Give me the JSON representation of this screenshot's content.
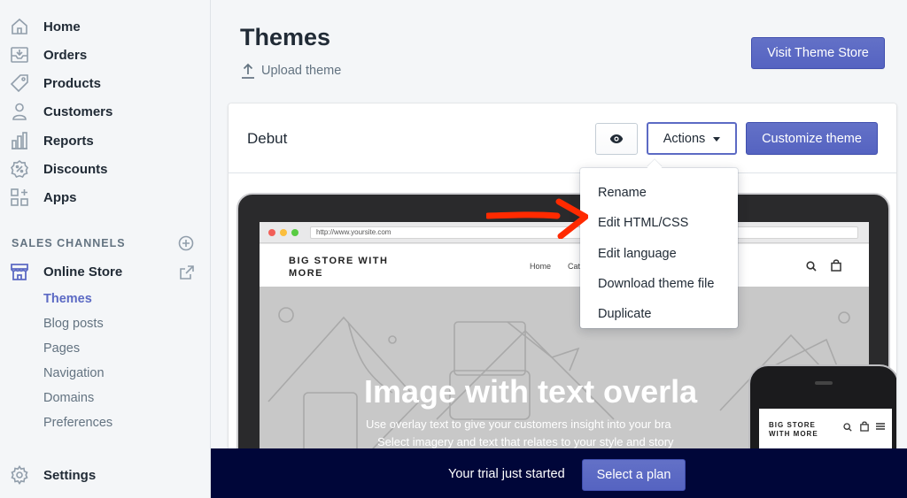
{
  "sidebar": {
    "items": [
      {
        "label": "Home",
        "icon": "home-icon"
      },
      {
        "label": "Orders",
        "icon": "orders-icon"
      },
      {
        "label": "Products",
        "icon": "tag-icon"
      },
      {
        "label": "Customers",
        "icon": "person-icon"
      },
      {
        "label": "Reports",
        "icon": "bar-chart-icon"
      },
      {
        "label": "Discounts",
        "icon": "discount-icon"
      },
      {
        "label": "Apps",
        "icon": "apps-icon"
      }
    ],
    "sales_channels_title": "SALES CHANNELS",
    "online_store": {
      "label": "Online Store",
      "icon": "store-icon"
    },
    "sub_items": [
      "Themes",
      "Blog posts",
      "Pages",
      "Navigation",
      "Domains",
      "Preferences"
    ],
    "active_sub_item": "Themes",
    "settings": {
      "label": "Settings",
      "icon": "gear-icon"
    }
  },
  "header": {
    "title": "Themes",
    "upload_label": "Upload theme",
    "visit_store_button": "Visit Theme Store"
  },
  "theme_card": {
    "name": "Debut",
    "actions_label": "Actions",
    "customize_label": "Customize theme",
    "preview_icon": "eye-icon"
  },
  "actions_menu": {
    "items": [
      "Rename",
      "Edit HTML/CSS",
      "Edit language",
      "Download theme file",
      "Duplicate"
    ],
    "highlighted": "Edit HTML/CSS"
  },
  "preview": {
    "url": "http://www.yoursite.com",
    "logo": "BIG STORE WITH MORE",
    "nav": [
      "Home",
      "Cat"
    ],
    "hero_title": "Image with text overla",
    "hero_sub1": "Use overlay text to give your customers insight into your bra",
    "hero_sub2": "Select imagery and text that relates to your style and story",
    "phone_logo": "BIG STORE WITH MORE"
  },
  "trial": {
    "text": "Your trial just started",
    "button": "Select a plan"
  },
  "colors": {
    "accent": "#5c6ac4",
    "arrow": "#ff2a00",
    "trial_bar": "#000639"
  }
}
